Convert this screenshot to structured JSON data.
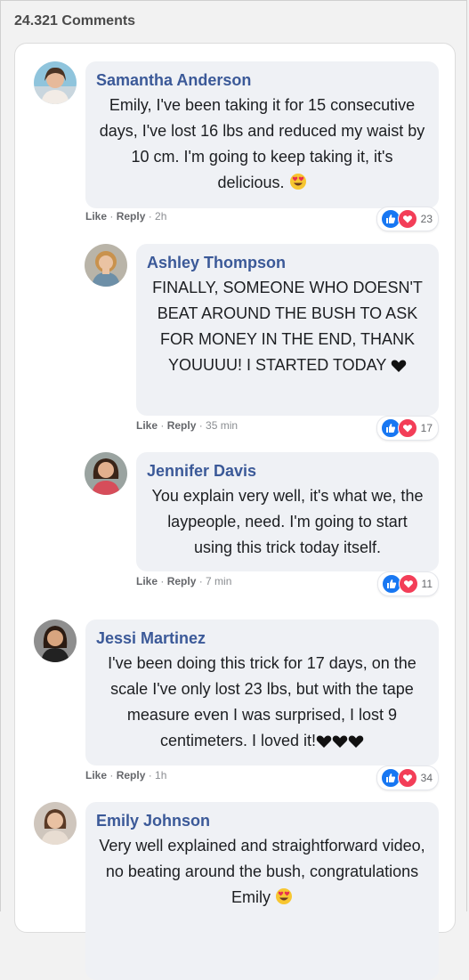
{
  "header": {
    "count_label": "24.321 Comments"
  },
  "comments": [
    {
      "name": "Samantha Anderson",
      "text": "Emily, I've been taking it for 15 consecutive days, I've lost 16 lbs and reduced my waist by 10 cm. I'm going to keep taking it, it's delicious.",
      "emoji": "heart-eyes-emoji",
      "like_label": "Like",
      "reply_label": "Reply",
      "time": "2h",
      "reactions": "23"
    },
    {
      "name": "Ashley Thompson",
      "text": "FINALLY, SOMEONE WHO DOESN'T BEAT AROUND THE BUSH TO ASK FOR MONEY IN THE END, THANK YOUUUU! I STARTED TODAY",
      "emoji": "black-heart-emoji",
      "like_label": "Like",
      "reply_label": "Reply",
      "time": "35 min",
      "reactions": "17"
    },
    {
      "name": "Jennifer Davis",
      "text": "You explain very well, it's what we, the laypeople, need. I'm going to start using this trick today itself.",
      "like_label": "Like",
      "reply_label": "Reply",
      "time": "7 min",
      "reactions": "11"
    },
    {
      "name": "Jessi Martinez",
      "text": "I've been doing this trick for 17 days, on the scale I've only lost 23 lbs, but with the tape measure even I was surprised, I lost 9 centimeters. I loved it!",
      "emoji": "three-black-hearts-emoji",
      "like_label": "Like",
      "reply_label": "Reply",
      "time": "1h",
      "reactions": "34"
    },
    {
      "name": "Emily Johnson",
      "text": "Very well explained and straightforward video, no beating around the bush, congratulations Emily",
      "emoji": "heart-eyes-emoji"
    }
  ],
  "colors": {
    "name": "#3b5998",
    "bubble": "#eff1f5",
    "like": "#1877f2",
    "love": "#f33e58"
  }
}
